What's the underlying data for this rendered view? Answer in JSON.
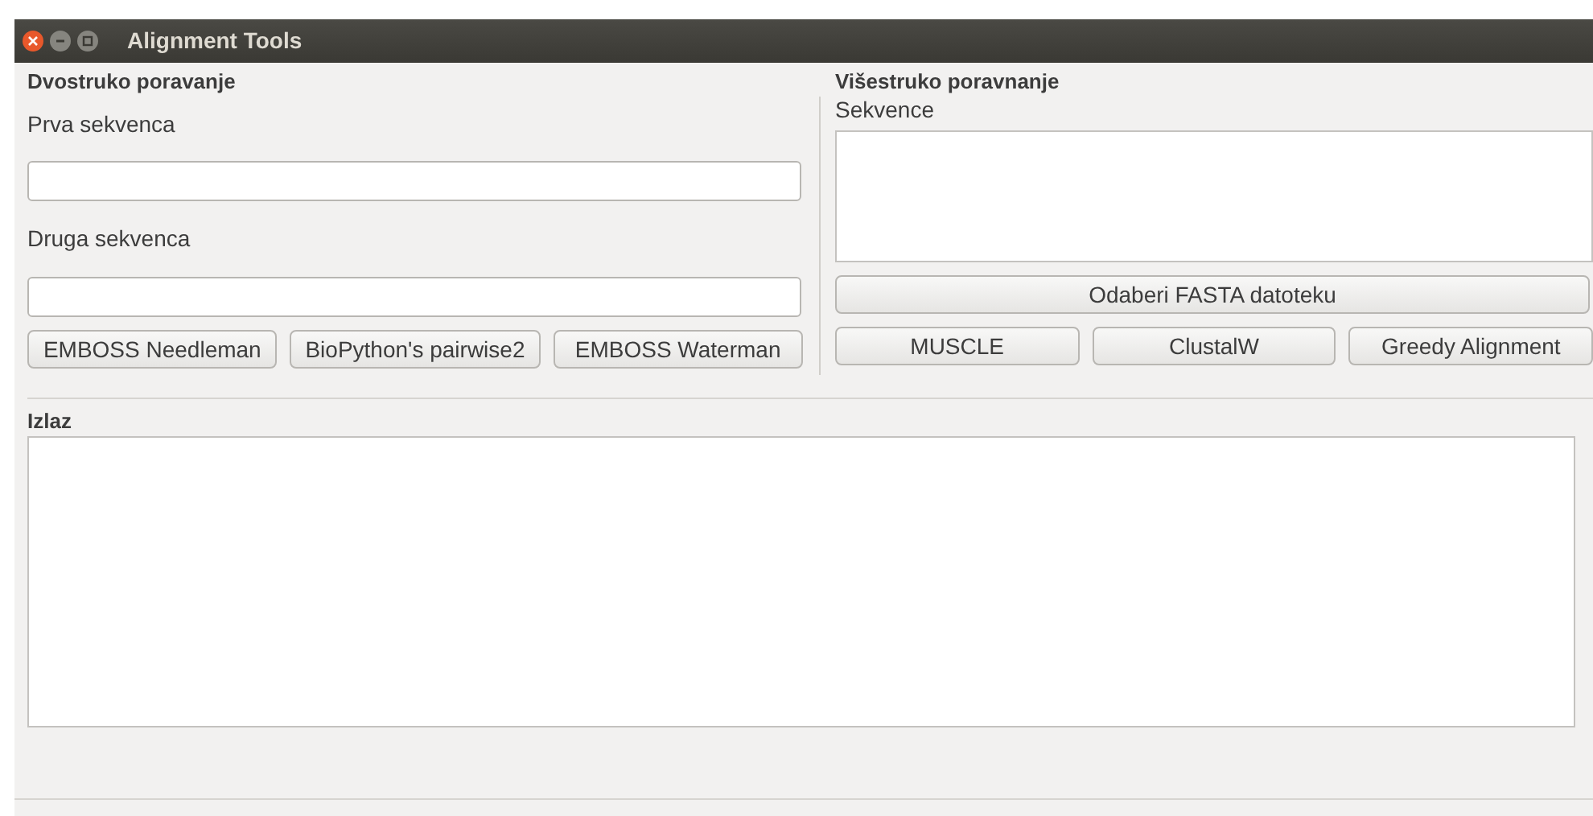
{
  "window": {
    "title": "Alignment Tools"
  },
  "pairwise": {
    "title": "Dvostruko poravanje",
    "first_label": "Prva sekvenca",
    "second_label": "Druga sekvenca",
    "buttons": [
      "EMBOSS Needleman",
      "BioPython's pairwise2",
      "EMBOSS Waterman"
    ]
  },
  "multiple": {
    "title": "Višestruko poravnanje",
    "sequences_label": "Sekvence",
    "file_button": "Odaberi FASTA datoteku",
    "buttons": [
      "MUSCLE",
      "ClustalW",
      "Greedy Alignment"
    ]
  },
  "output": {
    "title": "Izlaz"
  }
}
